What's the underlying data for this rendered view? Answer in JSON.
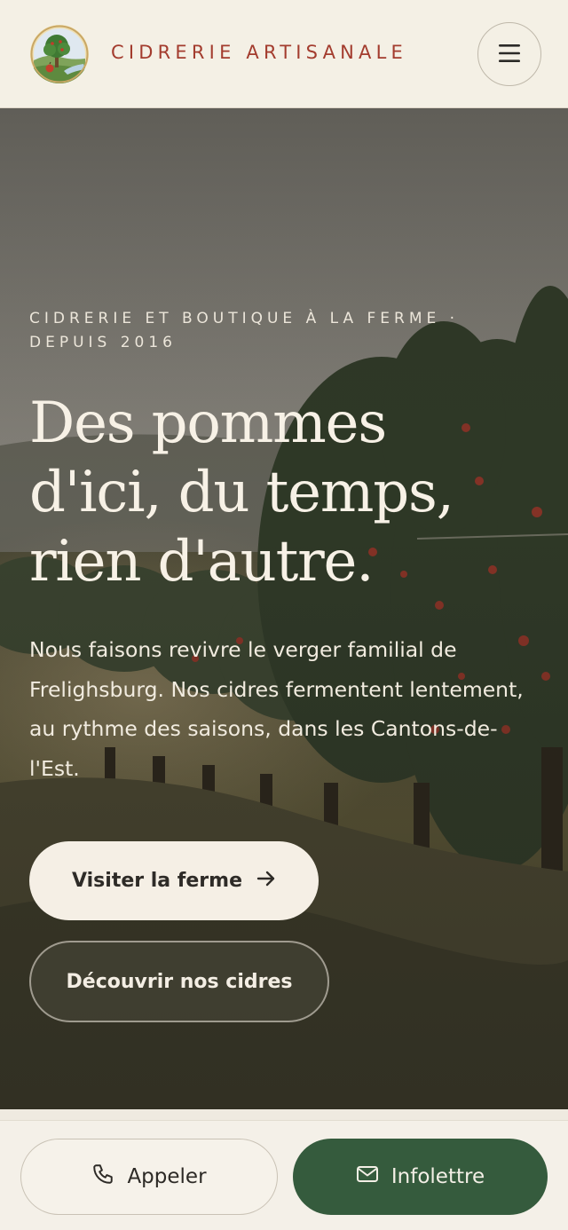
{
  "header": {
    "brand": "CIDRERIE ARTISANALE",
    "logo_icon": "apple-tree-logo-icon",
    "menu_icon": "hamburger-menu-icon"
  },
  "hero": {
    "eyebrow": "CIDRERIE ET BOUTIQUE À LA FERME · DEPUIS 2016",
    "title_line1": "Des pommes",
    "title_line2": "d'ici, du temps,",
    "title_line3": "rien d'autre.",
    "text": "Nous faisons revivre le verger familial de Frelighsburg. Nos cidres fermentent lentement, au rythme des saisons, dans les Cantons-de-l'Est.",
    "primary_button": "Visiter la ferme",
    "primary_button_icon": "arrow-right-icon",
    "secondary_button": "Découvrir nos cidres",
    "background": "apple-orchard-photo"
  },
  "bottom_bar": {
    "call_label": "Appeler",
    "call_icon": "phone-icon",
    "newsletter_label": "Infolettre",
    "newsletter_icon": "mail-icon"
  },
  "colors": {
    "brand": "#a33c2e",
    "cream": "#f4f0e5",
    "green": "#355b3d"
  }
}
